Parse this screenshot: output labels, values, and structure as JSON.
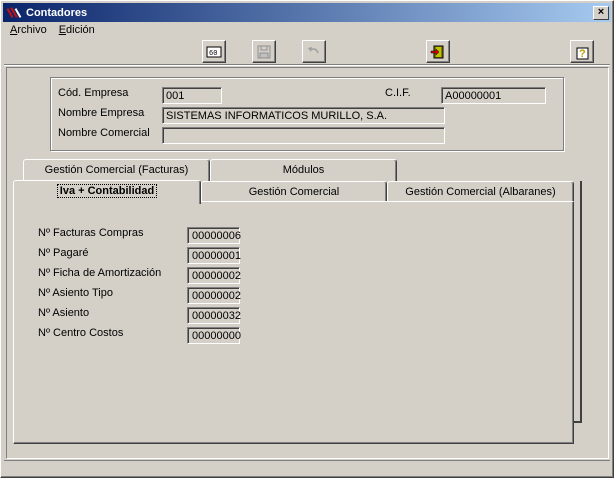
{
  "window": {
    "title": "Contadores"
  },
  "menu": [
    {
      "label": "Archivo",
      "accel": "A",
      "rest": "rchivo"
    },
    {
      "label": "Edición",
      "accel": "E",
      "rest": "dición"
    }
  ],
  "toolbar": {
    "buttons": [
      {
        "icon": "print-preview-icon",
        "enabled": true
      },
      {
        "icon": "save-icon",
        "enabled": false
      },
      {
        "icon": "undo-icon",
        "enabled": false
      },
      {
        "icon": "exit-door-icon",
        "enabled": true
      },
      {
        "icon": "help-icon",
        "enabled": true
      }
    ]
  },
  "header": {
    "cod_empresa_label": "Cód. Empresa",
    "cod_empresa_value": "001",
    "cif_label": "C.I.F.",
    "cif_value": "A00000001",
    "nombre_empresa_label": "Nombre Empresa",
    "nombre_empresa_value": "SISTEMAS INFORMATICOS MURILLO, S.A.",
    "nombre_comercial_label": "Nombre Comercial",
    "nombre_comercial_value": ""
  },
  "tabs": {
    "back_row": [
      "Gestión Comercial  (Facturas)",
      "Módulos"
    ],
    "front_row": [
      "Iva + Contabilidad",
      "Gestión Comercial",
      "Gestión Comercial  (Albaranes)"
    ],
    "active": "Iva + Contabilidad"
  },
  "counters": [
    {
      "label": "Nº Facturas Compras",
      "value": "00000006"
    },
    {
      "label": "Nº Pagaré",
      "value": "00000001"
    },
    {
      "label": "Nº Ficha de Amortización",
      "value": "00000002"
    },
    {
      "label": "Nº Asiento Tipo",
      "value": "00000002"
    },
    {
      "label": "Nº Asiento",
      "value": "00000032"
    },
    {
      "label": "Nº Centro Costos",
      "value": "00000000"
    }
  ]
}
